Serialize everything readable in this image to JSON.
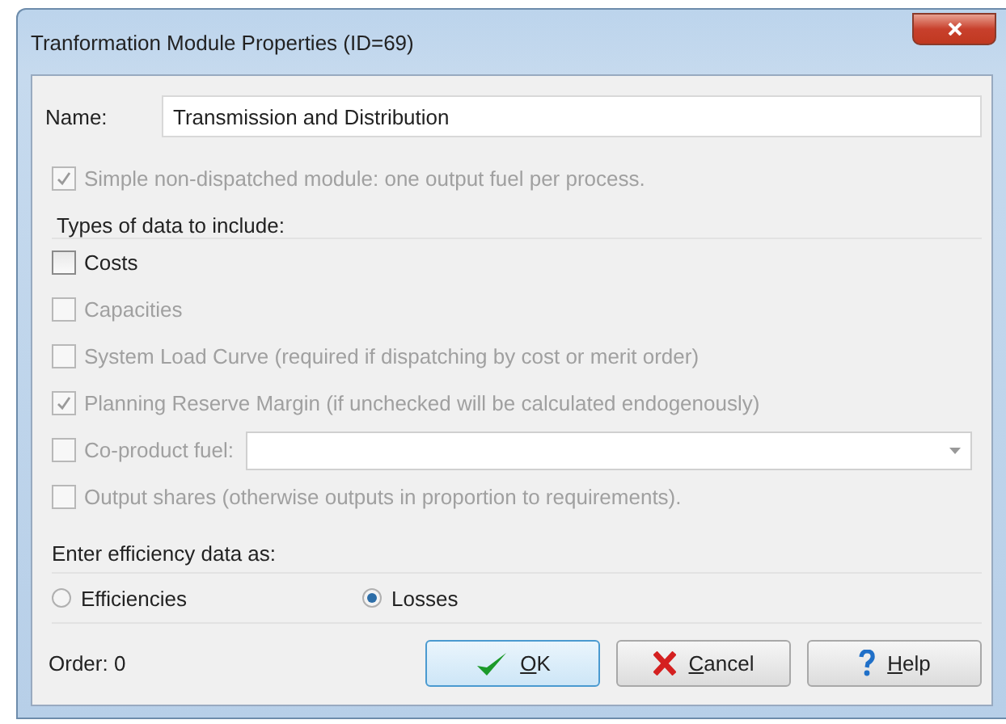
{
  "window": {
    "title": "Tranformation Module Properties (ID=69)"
  },
  "name_field": {
    "label": "Name:",
    "value": "Transmission and Distribution"
  },
  "simple_option": {
    "label": "Simple non-dispatched module: one output fuel per process.",
    "checked": true,
    "disabled": true
  },
  "data_types": {
    "heading": "Types of data to include:",
    "items": [
      {
        "kind": "checkbox",
        "label": "Costs",
        "checked": false,
        "disabled": false
      },
      {
        "kind": "checkbox",
        "label": "Capacities",
        "checked": false,
        "disabled": true
      },
      {
        "kind": "checkbox",
        "label": "System Load Curve (required if dispatching by cost or merit order)",
        "checked": false,
        "disabled": true
      },
      {
        "kind": "checkbox",
        "label": "Planning Reserve Margin (if unchecked will be calculated endogenously)",
        "checked": true,
        "disabled": true
      },
      {
        "kind": "combo",
        "label": "Co-product fuel:",
        "checked": false,
        "disabled": true
      },
      {
        "kind": "checkbox",
        "label": "Output shares (otherwise outputs in proportion to requirements).",
        "checked": false,
        "disabled": true
      }
    ]
  },
  "efficiency": {
    "heading": "Enter efficiency data as:",
    "options": [
      {
        "label": "Efficiencies",
        "selected": false
      },
      {
        "label": "Losses",
        "selected": true
      }
    ]
  },
  "footer": {
    "order": "Order: 0",
    "buttons": [
      {
        "kind": "ok",
        "label": "OK"
      },
      {
        "kind": "cancel",
        "label": "Cancel"
      },
      {
        "kind": "help",
        "label": "Help"
      }
    ]
  }
}
